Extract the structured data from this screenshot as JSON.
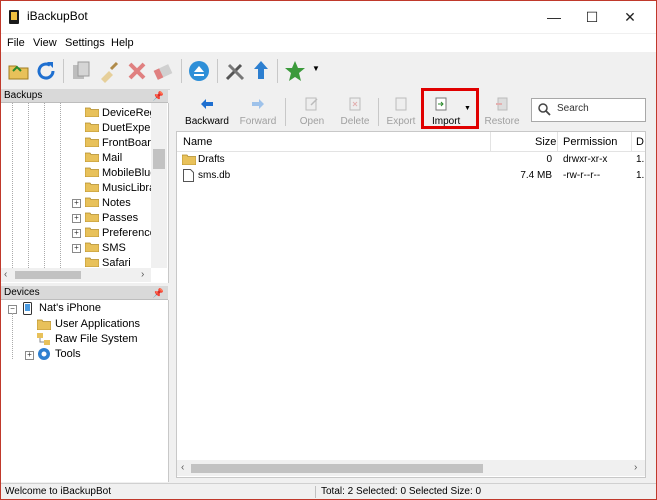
{
  "window": {
    "title": "iBackupBot",
    "controls": [
      "—",
      "☐",
      "✕"
    ]
  },
  "menu": [
    "File",
    "View",
    "Settings",
    "Help"
  ],
  "backups_panel": {
    "title": "Backups",
    "items": [
      {
        "label": "DeviceRegis",
        "expandable": false
      },
      {
        "label": "DuetExpertC",
        "expandable": false
      },
      {
        "label": "FrontBoard",
        "expandable": false
      },
      {
        "label": "Mail",
        "expandable": false
      },
      {
        "label": "MobileBlue",
        "expandable": false
      },
      {
        "label": "MusicLibrar",
        "expandable": false
      },
      {
        "label": "Notes",
        "expandable": true
      },
      {
        "label": "Passes",
        "expandable": true
      },
      {
        "label": "Preferences",
        "expandable": true
      },
      {
        "label": "SMS",
        "expandable": true
      },
      {
        "label": "Safari",
        "expandable": false
      }
    ]
  },
  "devices_panel": {
    "title": "Devices",
    "device": "Nat's iPhone",
    "children": [
      "User Applications",
      "Raw File System",
      "Tools"
    ]
  },
  "file_toolbar": {
    "backward": "Backward",
    "forward": "Forward",
    "open": "Open",
    "delete": "Delete",
    "export": "Export",
    "import": "Import",
    "restore": "Restore",
    "search_placeholder": "Search"
  },
  "columns": [
    "Name",
    "Size",
    "Permission",
    "D"
  ],
  "files": [
    {
      "name": "Drafts",
      "type": "folder",
      "size": "0",
      "permission": "drwxr-xr-x",
      "date": "1."
    },
    {
      "name": "sms.db",
      "type": "file",
      "size": "7.4 MB",
      "permission": "-rw-r--r--",
      "date": "1."
    }
  ],
  "status": {
    "left": "Welcome to iBackupBot",
    "right": "Total: 2 Selected: 0 Selected Size: 0"
  },
  "colors": {
    "highlight": "#e00000",
    "folder": "#e8c15a",
    "accent": "#1e6fd0"
  }
}
